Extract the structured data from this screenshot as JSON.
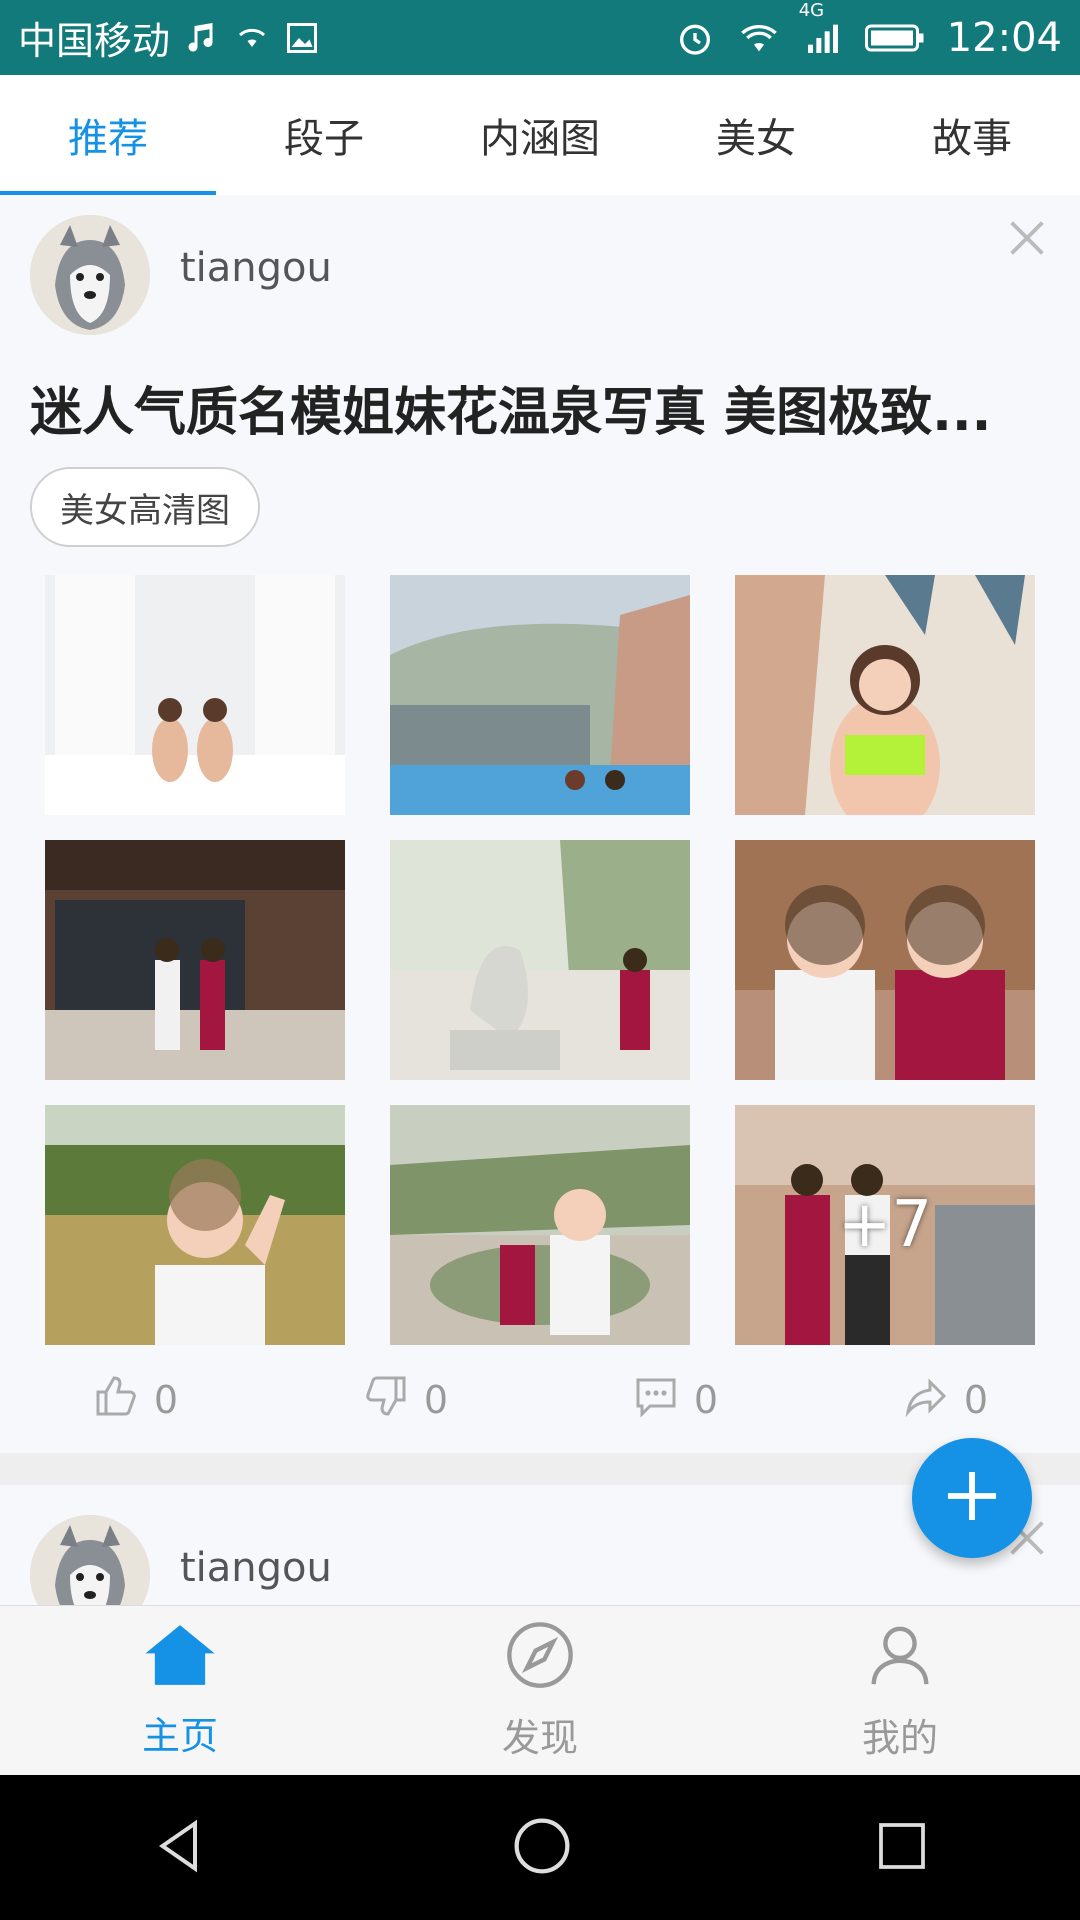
{
  "status_bar": {
    "carrier": "中国移动",
    "network": "4G",
    "time": "12:04"
  },
  "tabs": [
    {
      "label": "推荐",
      "active": true
    },
    {
      "label": "段子",
      "active": false
    },
    {
      "label": "内涵图",
      "active": false
    },
    {
      "label": "美女",
      "active": false
    },
    {
      "label": "故事",
      "active": false
    }
  ],
  "feed": {
    "card1": {
      "username": "tiangou",
      "title": "迷人气质名模姐妹花温泉写真 美图极致...",
      "tag": "美女高清图",
      "more_count": "+7",
      "actions": {
        "like_count": "0",
        "dislike_count": "0",
        "comment_count": "0",
        "share_count": "0"
      }
    },
    "card2": {
      "username": "tiangou"
    }
  },
  "bottom_nav": [
    {
      "label": "主页",
      "icon": "home-icon",
      "active": true
    },
    {
      "label": "发现",
      "icon": "compass-icon",
      "active": false
    },
    {
      "label": "我的",
      "icon": "profile-icon",
      "active": false
    }
  ],
  "colors": {
    "accent": "#1591e5",
    "status_bar": "#137a7b"
  }
}
